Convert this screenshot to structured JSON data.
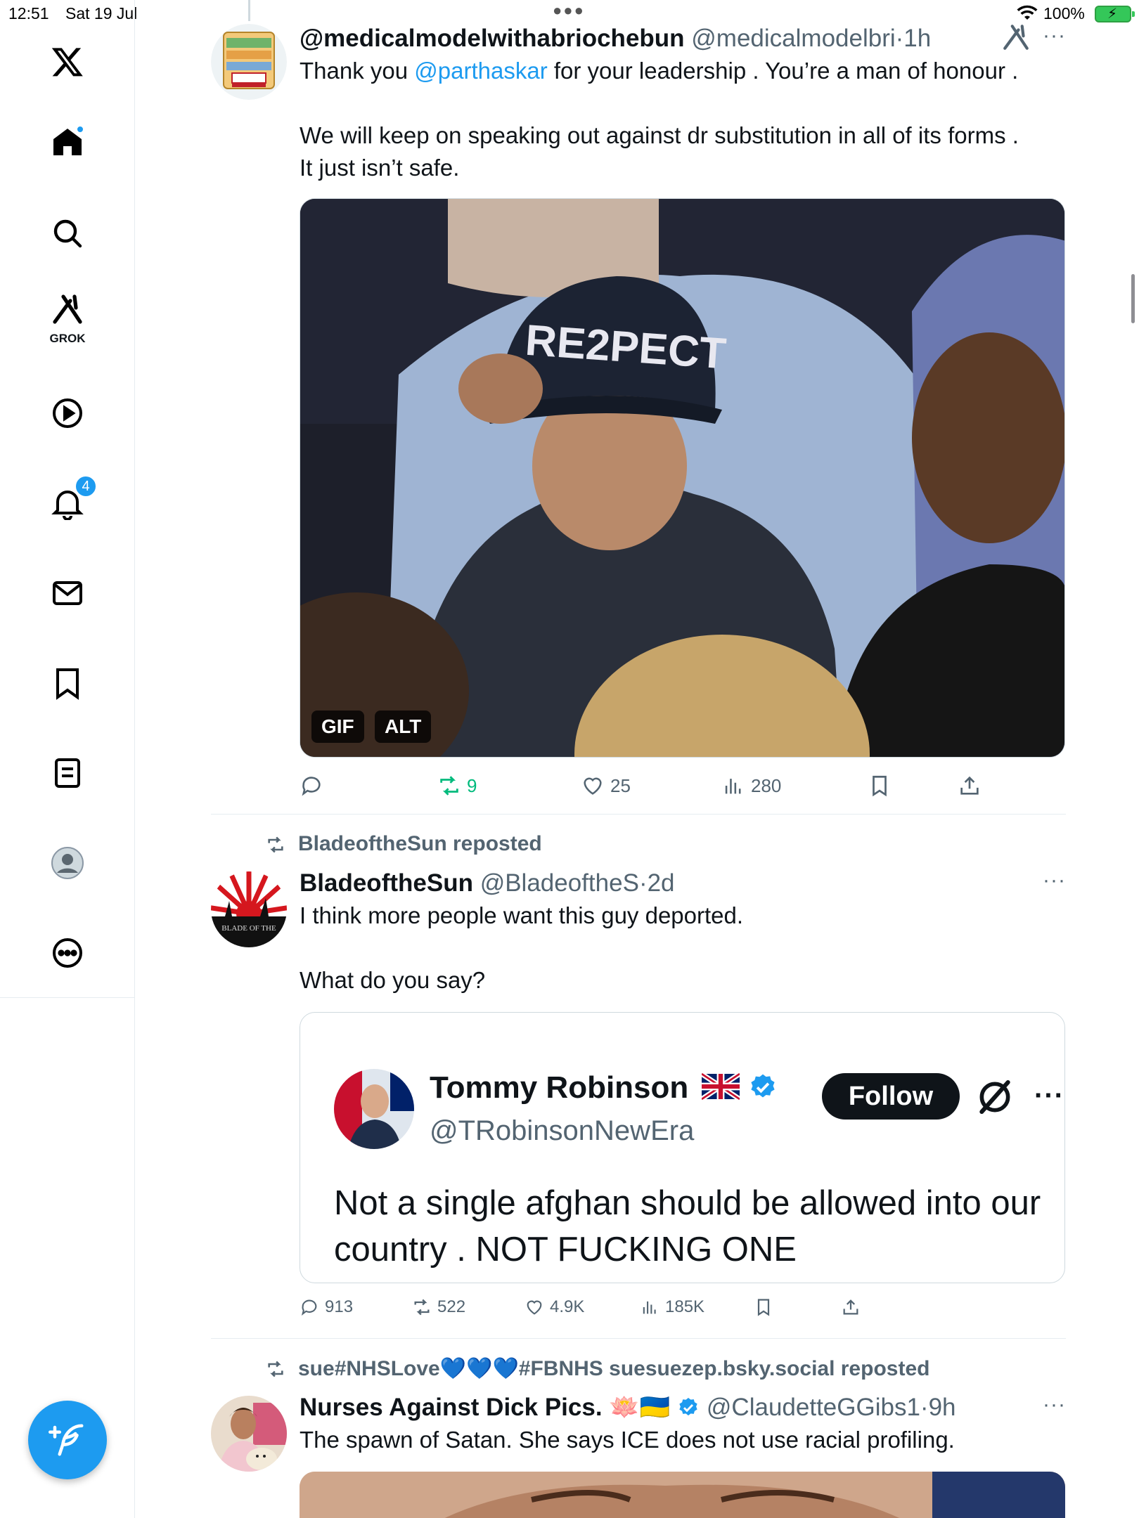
{
  "status_bar": {
    "time": "12:51",
    "date": "Sat 19 Jul",
    "battery": "100%"
  },
  "nav": {
    "grok_label": "GROK",
    "notifications_count": "4"
  },
  "tweets": [
    {
      "name": "@medicalmodelwithabriochebun",
      "handle": "@medicalmodelbri",
      "time": "1h",
      "more": "···",
      "text_before": "Thank you ",
      "mention": "@parthaskar",
      "text_after": " for your leadership . You’re a man of honour .\n\nWe will keep on speaking out against dr substitution in all of its forms .\nIt just isn’t safe.",
      "media_tags": [
        "GIF",
        "ALT"
      ],
      "media_caption": "RE2PECT",
      "stats": {
        "replies": "",
        "reposts": "9",
        "likes": "25",
        "views": "280"
      }
    },
    {
      "social_context": "BladeoftheSun reposted",
      "name": "BladeoftheSun",
      "handle": "@BladeoftheS",
      "time": "2d",
      "more": "···",
      "text": "I think more people want this guy deported.\n\nWhat do you say?",
      "avatar_text": "BLADE OF THE",
      "quote": {
        "name": "Tommy Robinson",
        "handle": "@TRobinsonNewEra",
        "follow_label": "Follow",
        "more": "···",
        "text": "Not a single afghan should be allowed into our\ncountry . NOT FUCKING ONE"
      },
      "stats": {
        "replies": "913",
        "reposts": "522",
        "likes": "4.9K",
        "views": "185K"
      }
    },
    {
      "social_context": "sue#NHSLove💙💙💙#FBNHS suesuezep.bsky.social reposted",
      "name": "Nurses Against Dick Pics. 🪷🇺🇦",
      "handle": "@ClaudetteGGibs1",
      "time": "9h",
      "more": "···",
      "text": "The spawn of Satan. She says ICE does not use racial profiling."
    }
  ],
  "colors": {
    "accent": "#1d9bf0",
    "repost_green": "#00ba7c",
    "secondary_text": "#536471"
  }
}
